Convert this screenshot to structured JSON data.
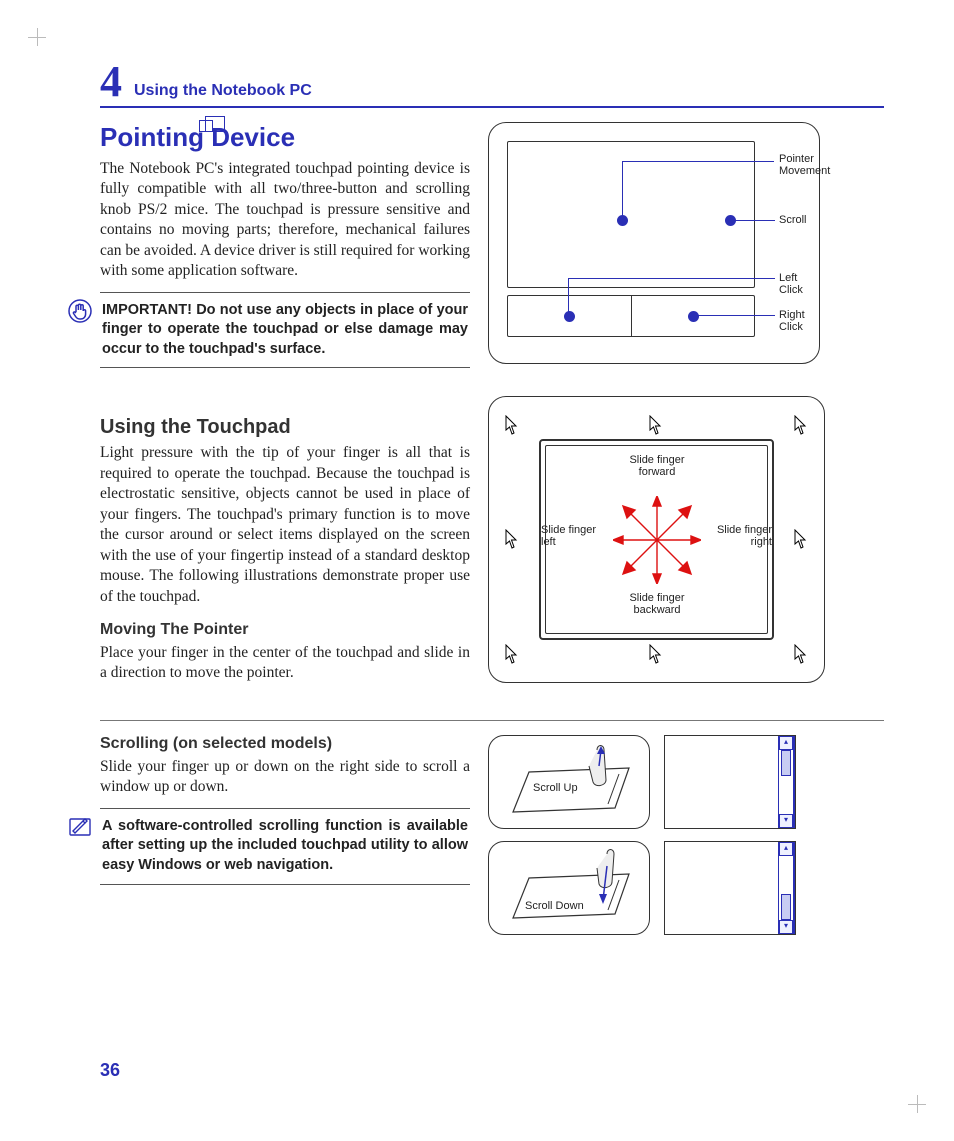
{
  "chapter": {
    "number": "4",
    "title": "Using the Notebook PC"
  },
  "page_number": "36",
  "h1": "Pointing Device",
  "p1": "The Notebook PC's integrated touchpad pointing device is fully compatible with all two/three-button and scrolling knob PS/2 mice. The touchpad is pressure sensitive and contains no moving parts; therefore, mechanical failures can be avoided. A device driver is still required for working with some application software.",
  "important_note": "IMPORTANT! Do not use any objects in place of your finger to operate the touchpad or else damage may occur to the touchpad's surface.",
  "h2_touchpad": "Using the Touchpad",
  "p2": "Light pressure with the tip of your finger is all that is required to operate the touchpad. Because the touchpad is electrostatic sensitive, objects cannot be used in place of your fingers. The touchpad's primary function is to move the cursor around or select items displayed on the screen with the use of your fingertip instead of a standard desktop mouse. The following illustrations demonstrate proper use of the touchpad.",
  "h3_moving": "Moving The Pointer",
  "p3": "Place your finger in the center of the touchpad and slide in a direction to move the pointer.",
  "h3_scrolling": "Scrolling (on selected models)",
  "p4": "Slide your finger up or down on the right side to scroll a window up or down.",
  "scroll_note": "A software-controlled scrolling function is available after setting up the included touchpad utility to allow easy Windows or web navigation.",
  "diagram1": {
    "pointer_movement": "Pointer\nMovement",
    "scroll": "Scroll",
    "left_click": "Left Click",
    "right_click": "Right Click"
  },
  "diagram2": {
    "forward": "Slide finger\nforward",
    "left": "Slide finger\nleft",
    "right": "Slide finger\nright",
    "backward": "Slide finger\nbackward"
  },
  "diagram3": {
    "scroll_up": "Scroll Up",
    "scroll_down": "Scroll Down"
  }
}
